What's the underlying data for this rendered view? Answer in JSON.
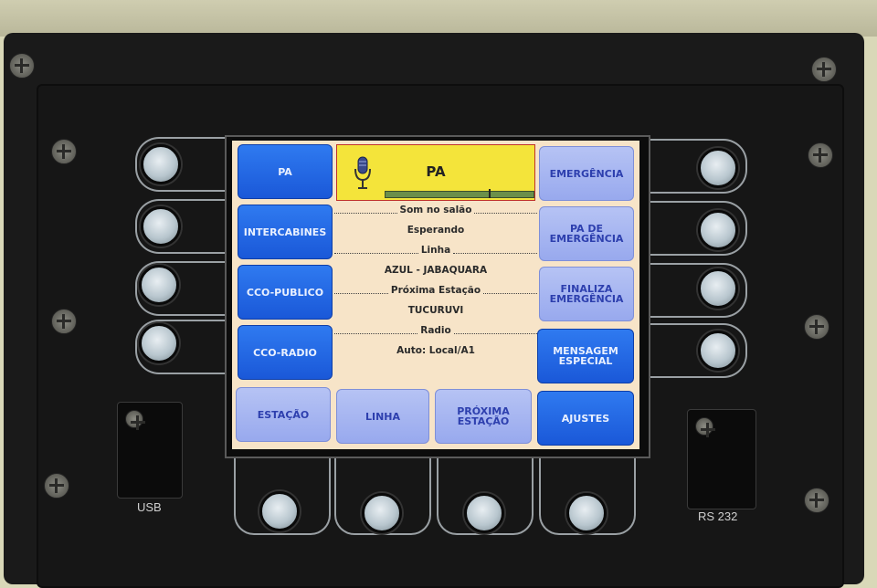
{
  "left_buttons": [
    {
      "label": "PA"
    },
    {
      "label": "INTERCABINES"
    },
    {
      "label": "CCO-PUBLICO"
    },
    {
      "label": "CCO-RADIO"
    }
  ],
  "right_buttons": [
    {
      "label": "EMERGÊNCIA"
    },
    {
      "label": "PA DE EMERGÊNCIA"
    },
    {
      "label": "FINALIZA EMERGÊNCIA"
    },
    {
      "label": "MENSAGEM ESPECIAL"
    }
  ],
  "bottom_buttons": [
    {
      "label": "ESTAÇÃO"
    },
    {
      "label": "LINHA"
    },
    {
      "label": "PRÓXIMA ESTAÇÃO"
    },
    {
      "label": "AJUSTES"
    }
  ],
  "header": {
    "title": "PA",
    "icon": "microphone-icon",
    "level_fraction": 0.7
  },
  "info": {
    "som_label": "Som no salão",
    "som_value": "Esperando",
    "linha_label": "Linha",
    "linha_value": "AZUL - JABAQUARA",
    "proxima_label": "Próxima Estação",
    "proxima_value": "TUCURUVI",
    "radio_label": "Radio",
    "radio_value": "Auto: Local/A1"
  },
  "ports": {
    "usb": "USB",
    "rs232": "RS 232"
  },
  "colors": {
    "screen_bg": "#f7e4c8",
    "active_button": "#2269e6",
    "inactive_button": "#a6b5f1",
    "header_bg": "#f4e43a"
  }
}
